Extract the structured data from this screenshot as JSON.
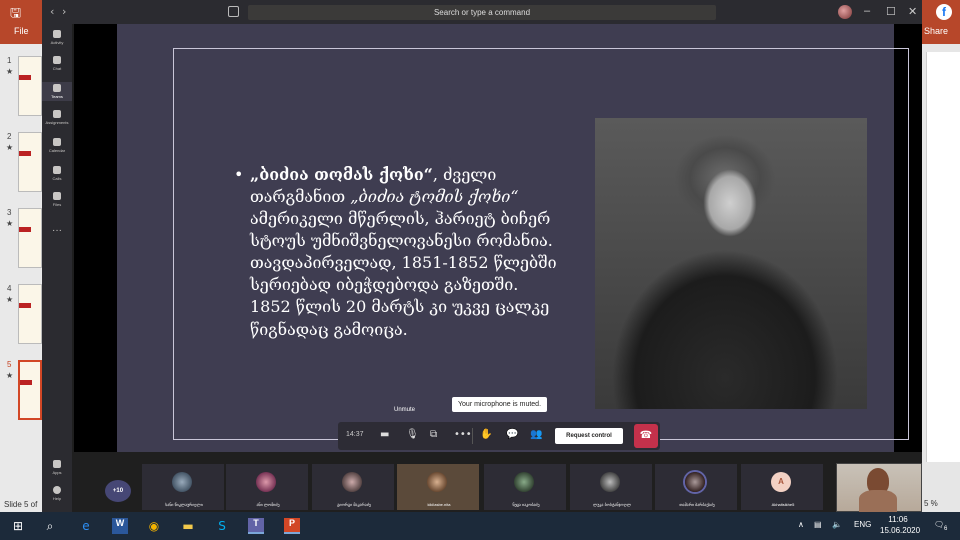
{
  "powerpoint": {
    "file_label": "File",
    "share_label": "Share",
    "status_text": "Slide 5 of",
    "zoom_text": "5 %",
    "thumbnails": [
      {
        "num": "1",
        "star": "★"
      },
      {
        "num": "2",
        "star": "★"
      },
      {
        "num": "3",
        "star": "★"
      },
      {
        "num": "4",
        "star": "★"
      },
      {
        "num": "5",
        "star": "★"
      }
    ]
  },
  "teams": {
    "search_placeholder": "Search or type a command",
    "rail": [
      {
        "label": "Activity"
      },
      {
        "label": "Chat"
      },
      {
        "label": "Teams"
      },
      {
        "label": "Assignments"
      },
      {
        "label": "Calendar"
      },
      {
        "label": "Calls"
      },
      {
        "label": "Files"
      },
      {
        "label": "Apps"
      },
      {
        "label": "Help"
      }
    ],
    "slide": {
      "bullet": "•",
      "title_bold": "„ბიძია თომას ქოხი“",
      "text_1": ", ძველი თარგმანით ",
      "title_italic": "„ბიძია ტომის ქოხი“",
      "text_2": " ამერიკელი მწერლის, ჰარიეტ ბიჩერ სტოუს უმნიშვნელოვანესი რომანია. თავდაპირველად, 1851-1852 წლებში სერიებად იბეჭდებოდა გაზეთში. 1852 წლის 20 მარტს კი უკვე ცალკე წიგნადაც გამოიცა."
    },
    "presenter_name": "თამარი ბარბაქაძე",
    "tooltip_muted": "Your microphone is muted.",
    "tooltip_unmute": "Unmute",
    "callbar": {
      "timer": "14:37",
      "request_control": "Request control"
    },
    "participants": {
      "more": "+10",
      "cards": [
        {
          "name": "სანი წიკლაურიელი"
        },
        {
          "name": "ანი ლომიძე"
        },
        {
          "name": "გიორგი მაკარაძე"
        },
        {
          "name": "kikilasbe.nita"
        },
        {
          "name": "ნუცა იაკობაძე"
        },
        {
          "name": "ლუკა ბოსტანჯოღლ"
        },
        {
          "name": "თამარი ბარბაქაძე"
        },
        {
          "name": "Akhaltsikhe5"
        }
      ]
    }
  },
  "taskbar": {
    "lang": "ENG",
    "time": "11:06",
    "date": "15.06.2020",
    "notifications": "6"
  }
}
